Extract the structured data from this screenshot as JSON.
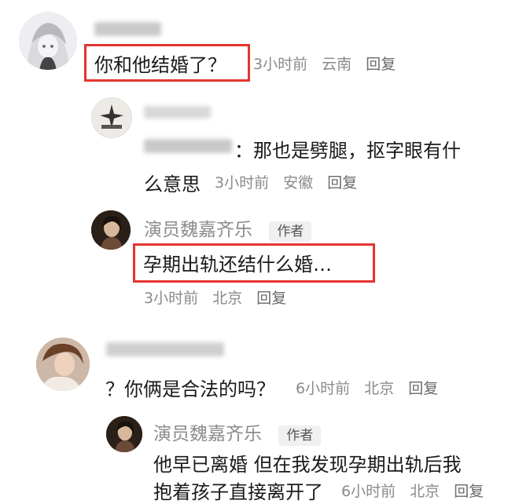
{
  "comments": [
    {
      "text": "你和他结婚了？",
      "time": "3小时前",
      "location": "云南",
      "reply": "回复"
    },
    {
      "text": "：那也是劈腿，抠字眼有什",
      "text_line2": "么意思",
      "time": "3小时前",
      "location": "安徽",
      "reply": "回复"
    },
    {
      "username": "演员魏嘉齐乐",
      "badge": "作者",
      "text": "孕期出轨还结什么婚…",
      "time": "3小时前",
      "location": "北京",
      "reply": "回复"
    },
    {
      "text": "？你俩是合法的吗？",
      "time": "6小时前",
      "location": "北京",
      "reply": "回复"
    },
    {
      "username": "演员魏嘉齐乐",
      "badge": "作者",
      "text": "他早已离婚  但在我发现孕期出轨后我",
      "text_line2": "抱着孩子直接离开了",
      "time": "6小时前",
      "location": "北京",
      "reply": "回复"
    }
  ]
}
